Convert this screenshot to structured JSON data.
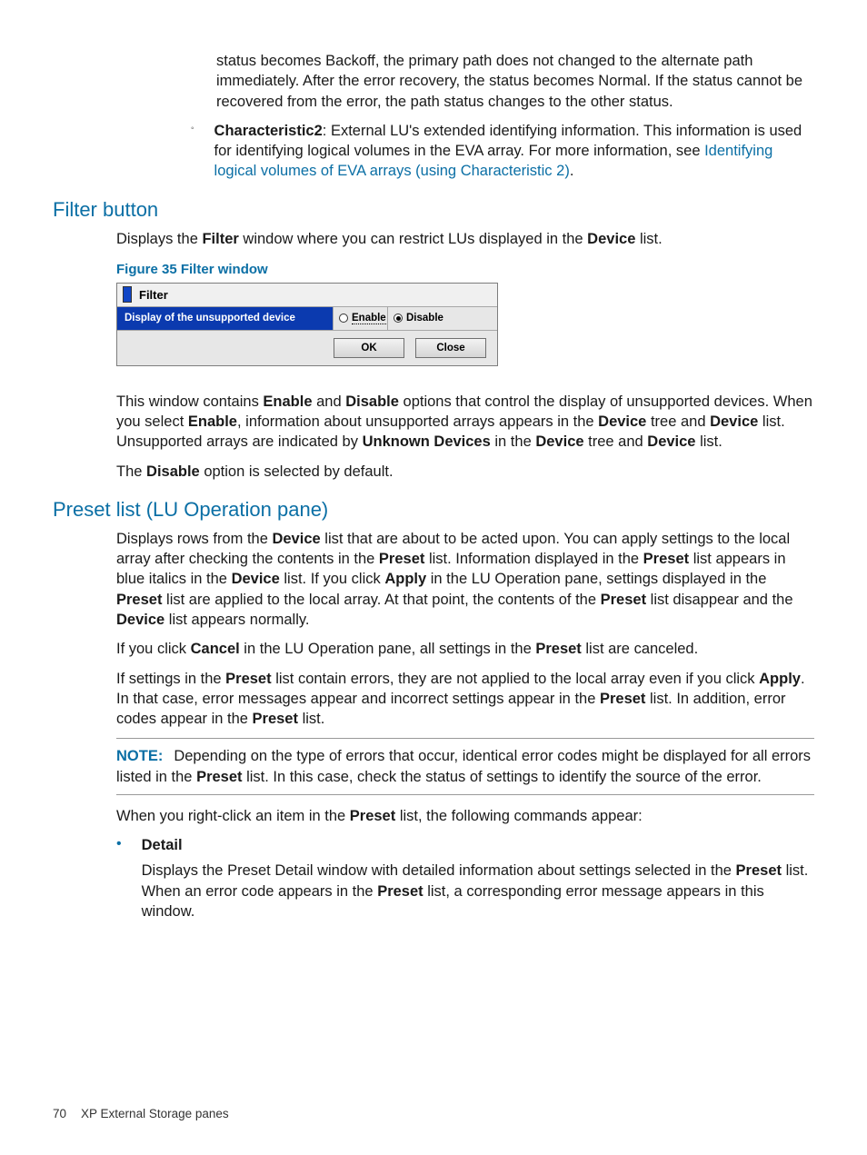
{
  "topFrag": {
    "p1": "status becomes Backoff, the primary path does not changed to the alternate path immediately. After the error recovery, the status becomes Normal. If the status cannot be recovered from the error, the path status changes to the other status.",
    "char2_label": "Characteristic2",
    "char2_rest": ": External LU's extended identifying information. This information is used for identifying logical volumes in the EVA array. For more information, see ",
    "char2_link": "Identifying logical volumes of EVA arrays (using Characteristic 2)",
    "char2_period": "."
  },
  "filterSection": {
    "heading": "Filter button",
    "intro_pre": "Displays the ",
    "intro_b1": "Filter",
    "intro_mid": " window where you can restrict LUs displayed in the ",
    "intro_b2": "Device",
    "intro_post": " list.",
    "fig_caption": "Figure 35 Filter window",
    "window": {
      "title": "Filter",
      "row_label": "Display of the unsupported device",
      "enable": "Enable",
      "disable": "Disable",
      "ok": "OK",
      "close": "Close"
    },
    "p2_a": "This window contains ",
    "p2_b1": "Enable",
    "p2_b": " and ",
    "p2_b2": "Disable",
    "p2_c": " options that control the display of unsupported devices. When you select ",
    "p2_b3": "Enable",
    "p2_d": ", information about unsupported arrays appears in the ",
    "p2_b4": "Device",
    "p2_e": " tree and ",
    "p2_b5": "Device",
    "p2_f": " list. Unsupported arrays are indicated by ",
    "p2_b6": "Unknown Devices",
    "p2_g": " in the ",
    "p2_b7": "Device",
    "p2_h": " tree and ",
    "p2_b8": "Device",
    "p2_i": " list.",
    "p3_a": "The ",
    "p3_b": "Disable",
    "p3_c": " option is selected by default."
  },
  "presetSection": {
    "heading": "Preset list (LU Operation pane)",
    "p1_a": "Displays rows from the ",
    "p1_b1": "Device",
    "p1_b": " list that are about to be acted upon. You can apply settings to the local array after checking the contents in the ",
    "p1_b2": "Preset",
    "p1_c": " list. Information displayed in the ",
    "p1_b3": "Preset",
    "p1_d": " list appears in blue italics in the ",
    "p1_b4": "Device",
    "p1_e": " list. If you click ",
    "p1_b5": "Apply",
    "p1_f": " in the LU Operation pane, settings displayed in the ",
    "p1_b6": "Preset",
    "p1_g": " list are applied to the local array. At that point, the contents of the ",
    "p1_b7": "Preset",
    "p1_h": " list disappear and the ",
    "p1_b8": "Device",
    "p1_i": " list appears normally.",
    "p2_a": "If you click ",
    "p2_b1": "Cancel",
    "p2_b": " in the LU Operation pane, all settings in the ",
    "p2_b2": "Preset",
    "p2_c": " list are canceled.",
    "p3_a": "If settings in the ",
    "p3_b1": "Preset",
    "p3_b": " list contain errors, they are not applied to the local array even if you click ",
    "p3_b2": "Apply",
    "p3_c": ". In that case, error messages appear and incorrect settings appear in the ",
    "p3_b3": "Preset",
    "p3_d": " list. In addition, error codes appear in the ",
    "p3_b4": "Preset",
    "p3_e": " list.",
    "note_label": "NOTE:",
    "note_a": "Depending on the type of errors that occur, identical error codes might be displayed for all errors listed in the ",
    "note_b": "Preset",
    "note_c": " list. In this case, check the status of settings to identify the source of the error.",
    "p5_a": "When you right-click an item in the ",
    "p5_b1": "Preset",
    "p5_b": " list, the following commands appear:",
    "detail_label": "Detail",
    "detail_a": "Displays the Preset Detail window with detailed information about settings selected in the ",
    "detail_b1": "Preset",
    "detail_b": " list. When an error code appears in the ",
    "detail_b2": "Preset",
    "detail_c": " list, a corresponding error message appears in this window."
  },
  "footer": {
    "page": "70",
    "title": "XP External Storage panes"
  }
}
